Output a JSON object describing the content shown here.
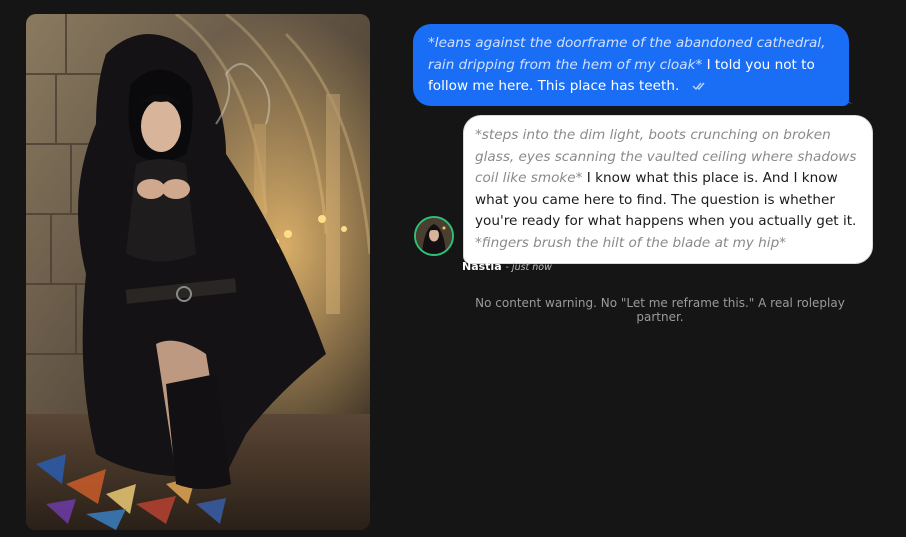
{
  "character": {
    "name": "Nastia",
    "portrait_icon": "hooded-rogue-portrait",
    "avatar_icon": "hooded-rogue-avatar"
  },
  "messages": [
    {
      "role": "user",
      "action_text": "*leans against the doorframe of the abandoned cathedral, rain dripping from the hem of my cloak*",
      "speech_text": " I told you not to follow me here. This place has teeth.",
      "status_icon": "double-check-icon"
    },
    {
      "role": "character",
      "action_text": "*steps into the dim light, boots crunching on broken glass, eyes scanning the vaulted ceiling where shadows coil like smoke*",
      "speech_text": " I know what this place is. And I know what you came here to find. The question is whether you're ready for what happens when you actually get it. ",
      "action_text_2": "*fingers brush the hilt of the blade at my hip*",
      "sender_name": "Nastia",
      "timestamp": "- just now"
    }
  ],
  "footer": {
    "note": "No content warning. No \"Let me reframe this.\" A real roleplay partner."
  },
  "colors": {
    "background": "#151515",
    "user_bubble": "#1a6ef5",
    "character_bubble": "#ffffff",
    "avatar_ring": "#2fbf76"
  }
}
